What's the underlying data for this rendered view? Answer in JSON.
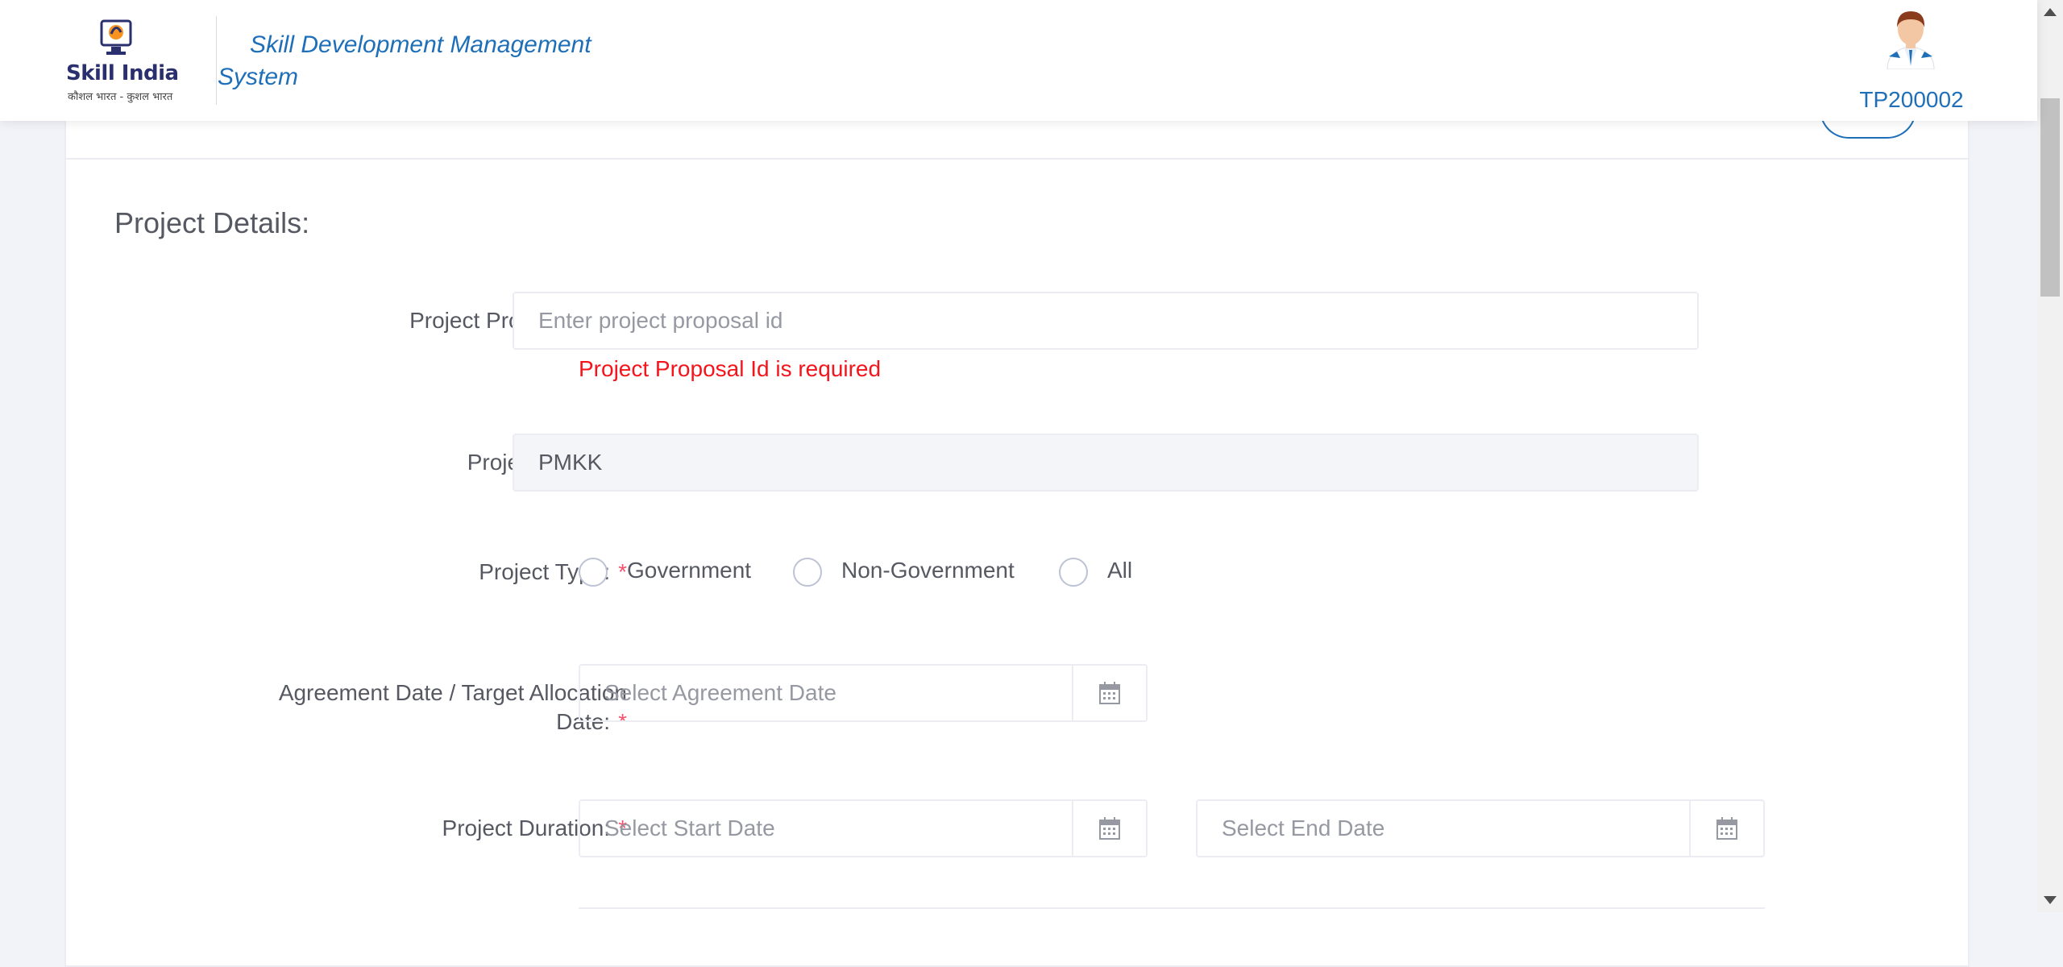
{
  "header": {
    "logo": {
      "brand": "Skill India",
      "tagline": "कौशल भारत - कुशल भारत"
    },
    "app_title": "Skill Development Management System",
    "user_id": "TP200002"
  },
  "form": {
    "section_title": "Project Details:",
    "required_marker": "*",
    "project_proposal_id": {
      "label": "Project Proposal ID:",
      "placeholder": "Enter project proposal id",
      "value": "",
      "error": "Project Proposal Id is required"
    },
    "project_name": {
      "label": "Project Name:",
      "value": "PMKK"
    },
    "project_type": {
      "label": "Project Type:",
      "options": [
        "Government",
        "Non-Government",
        "All"
      ]
    },
    "agreement_date": {
      "label": "Agreement Date / Target Allocation Date:",
      "placeholder": "Select Agreement Date"
    },
    "project_duration": {
      "label": "Project Duration:",
      "start_placeholder": "Select Start Date",
      "end_placeholder": "Select End Date"
    }
  },
  "colors": {
    "accent": "#1e6fb8",
    "required": "#f4516c",
    "error": "#f4151c",
    "page_bg": "#f2f3f8"
  },
  "icons": [
    "calendar-icon",
    "user-avatar-icon",
    "skill-india-emblem"
  ]
}
